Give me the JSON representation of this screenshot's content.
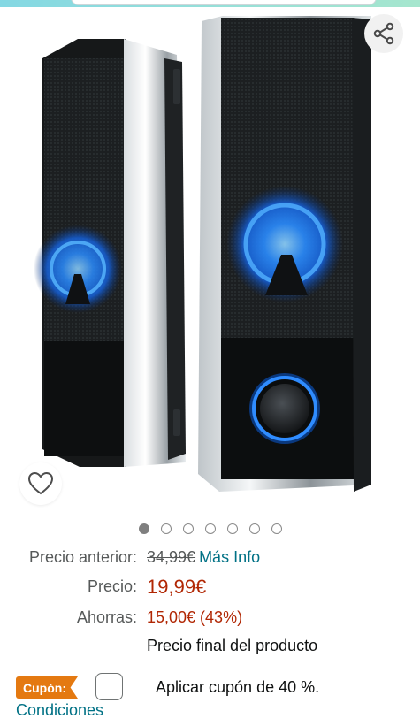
{
  "gallery": {
    "image_alt": "Altavoces de PC negros con luz azul",
    "dots_total": 7,
    "active_index": 0,
    "share_icon": "share-icon",
    "wishlist_icon": "heart-outline-icon"
  },
  "pricing": {
    "previous_label": "Precio anterior:",
    "previous_value": "34,99€",
    "more_info": "Más Info",
    "price_label": "Precio:",
    "price_value": "19,99€",
    "savings_label": "Ahorras:",
    "savings_value": "15,00€ (43%)",
    "final_note": "Precio final del producto"
  },
  "coupon": {
    "badge": "Cupón:",
    "text": "Aplicar cupón de 40 %.",
    "conditions": "Condiciones"
  },
  "colors": {
    "accent_link": "#007185",
    "price_red": "#b12704",
    "coupon_orange": "#e47911"
  }
}
